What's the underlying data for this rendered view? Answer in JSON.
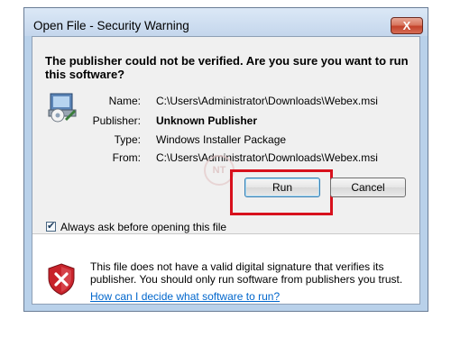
{
  "dialog": {
    "title": "Open File - Security Warning",
    "close_label": "X",
    "heading": "The publisher could not be verified.  Are you sure you want to run this software?",
    "fields": [
      {
        "label": "Name:",
        "value": "C:\\Users\\Administrator\\Downloads\\Webex.msi",
        "bold": false
      },
      {
        "label": "Publisher:",
        "value": "Unknown Publisher",
        "bold": true
      },
      {
        "label": "Type:",
        "value": "Windows Installer Package",
        "bold": false
      },
      {
        "label": "From:",
        "value": "C:\\Users\\Administrator\\Downloads\\Webex.msi",
        "bold": false
      }
    ],
    "run_label": "Run",
    "cancel_label": "Cancel",
    "checkbox_label": "Always ask before opening this file",
    "checkbox_checked": true,
    "info_text": "This file does not have a valid digital signature that verifies its publisher.  You should only run software from publishers you trust.",
    "help_link": "How can I decide what software to run?",
    "watermark_text": "NT",
    "accent_red": "#d8111d",
    "link_color": "#0066cc"
  }
}
